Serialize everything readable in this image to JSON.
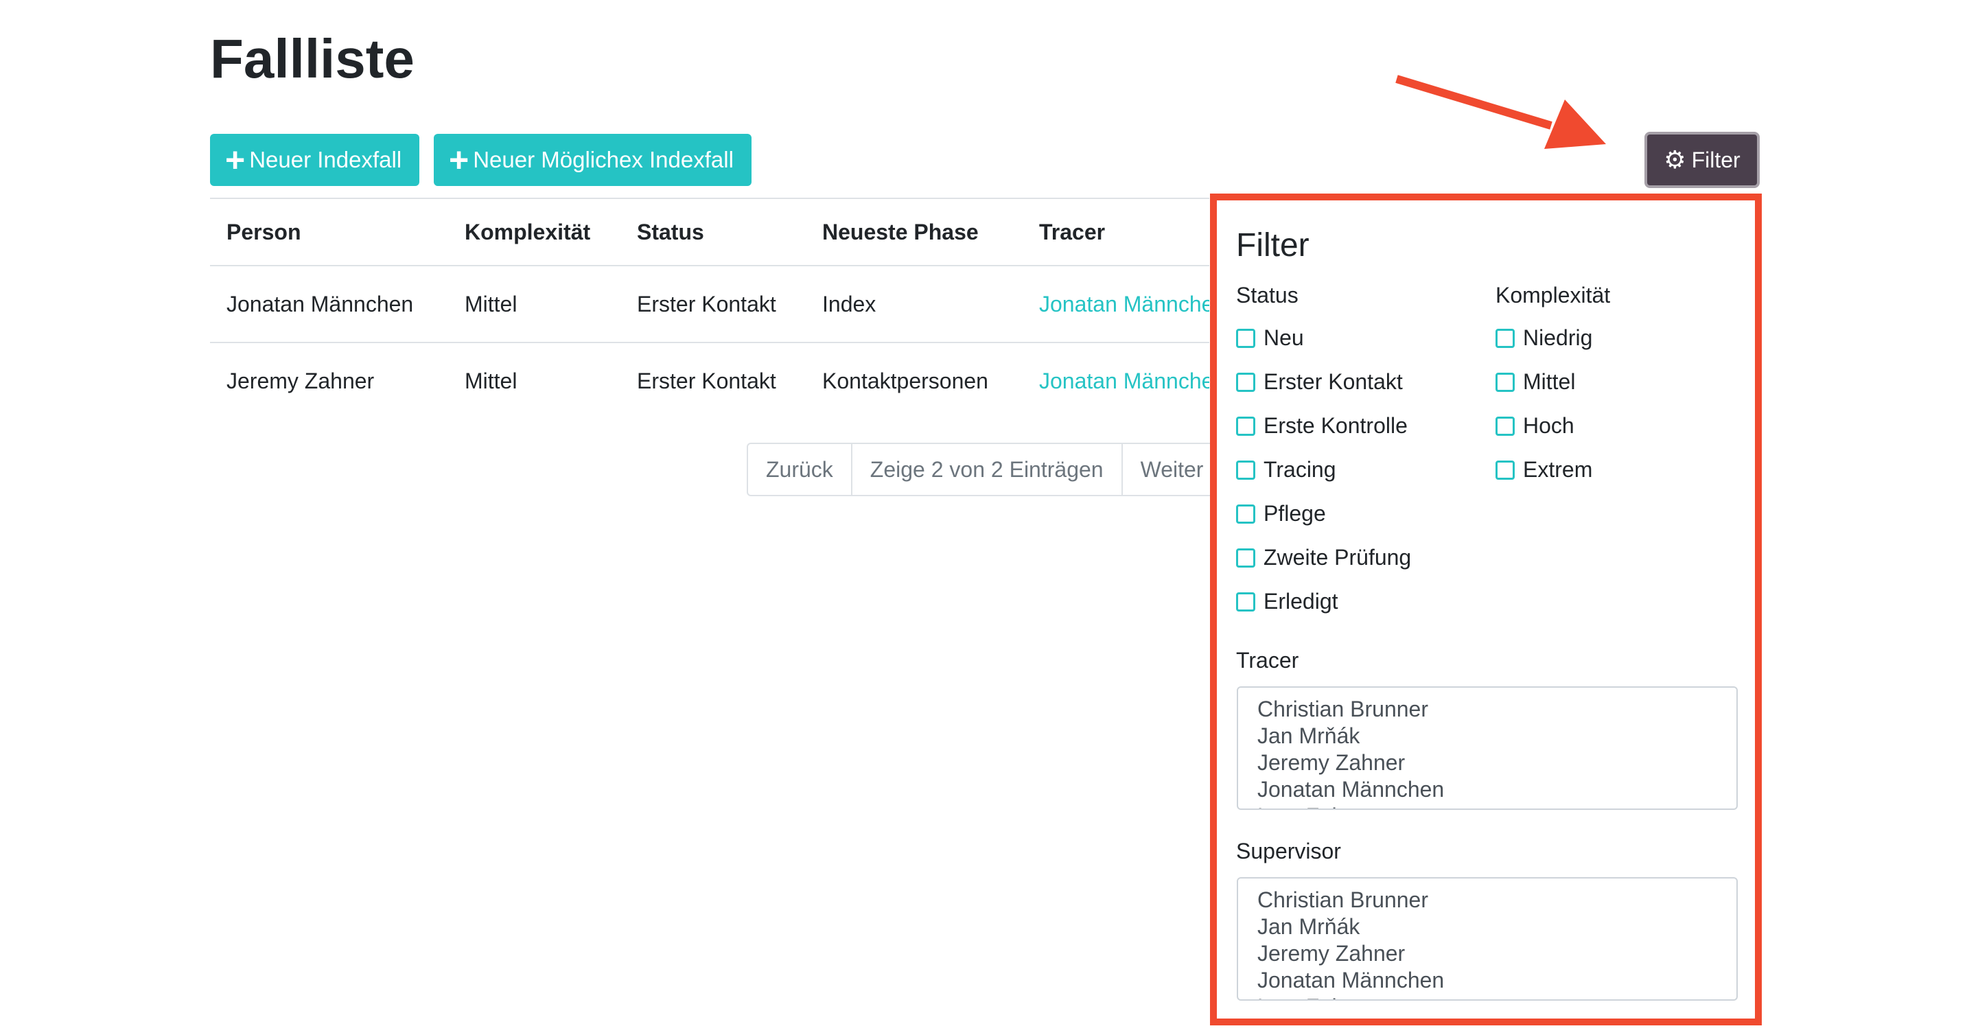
{
  "page": {
    "title": "Fallliste"
  },
  "toolbar": {
    "new_index": "Neuer Indexfall",
    "new_possible_index": "Neuer Möglichex Indexfall",
    "filter": "Filter"
  },
  "table": {
    "headers": [
      "Person",
      "Komplexität",
      "Status",
      "Neueste Phase",
      "Tracer"
    ],
    "rows": [
      [
        "Jonatan Männchen",
        "Mittel",
        "Erster Kontakt",
        "Index",
        "Jonatan Männchen"
      ],
      [
        "Jeremy Zahner",
        "Mittel",
        "Erster Kontakt",
        "Kontaktpersonen",
        "Jonatan Männchen"
      ]
    ]
  },
  "pagination": {
    "prev": "Zurück",
    "info": "Zeige 2 von 2 Einträgen",
    "next": "Weiter"
  },
  "filter_panel": {
    "title": "Filter",
    "status_label": "Status",
    "status_options": [
      "Neu",
      "Erster Kontakt",
      "Erste Kontrolle",
      "Tracing",
      "Pflege",
      "Zweite Prüfung",
      "Erledigt"
    ],
    "complexity_label": "Komplexität",
    "complexity_options": [
      "Niedrig",
      "Mittel",
      "Hoch",
      "Extrem"
    ],
    "tracer_label": "Tracer",
    "tracer_options": [
      "Christian Brunner",
      "Jan Mrňák",
      "Jeremy Zahner",
      "Jonatan Männchen",
      "Lars Zahner"
    ],
    "supervisor_label": "Supervisor",
    "supervisor_options": [
      "Christian Brunner",
      "Jan Mrňák",
      "Jeremy Zahner",
      "Jonatan Männchen",
      "Lars Zahner"
    ]
  },
  "colors": {
    "accent": "#25c3c4",
    "annotation": "#f04a2f",
    "filter_button": "#4a3f4c"
  }
}
